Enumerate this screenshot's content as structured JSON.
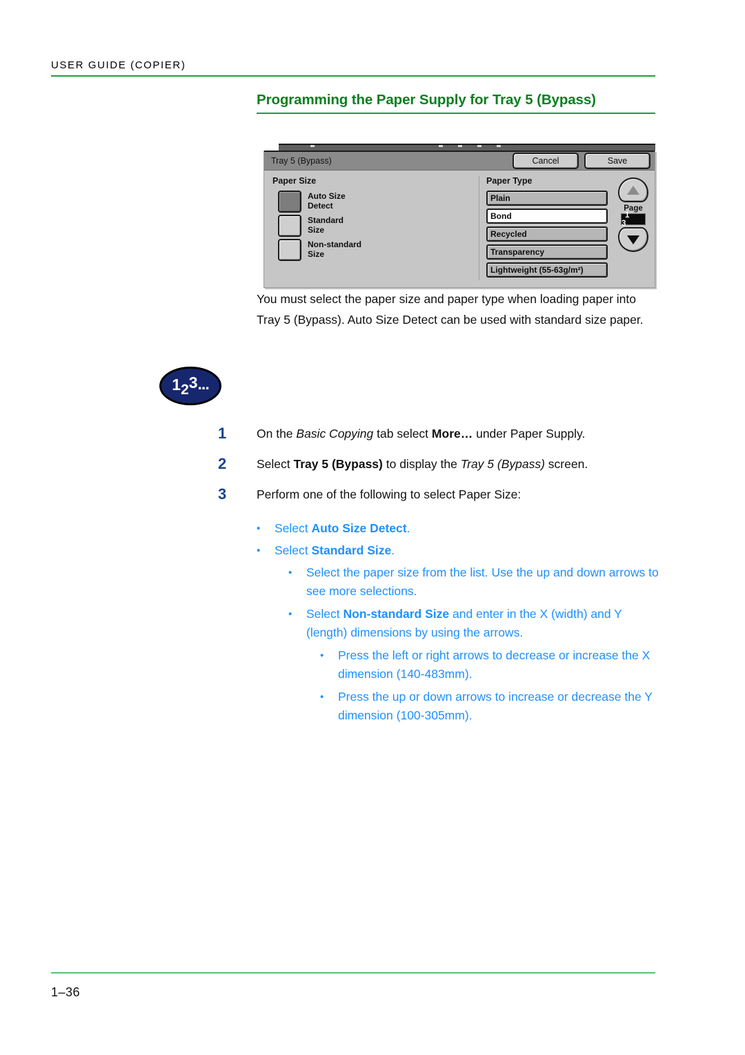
{
  "running_header": {
    "text": "User Guide (Copier)"
  },
  "section": {
    "title": "Programming the Paper Supply for Tray 5 (Bypass)"
  },
  "figure": {
    "titlebar": {
      "title": "Tray 5 (Bypass)",
      "cancel_label": "Cancel",
      "save_label": "Save"
    },
    "paper_size": {
      "group_label": "Paper Size",
      "options": [
        {
          "line1": "Auto Size",
          "line2": "Detect",
          "selected": true
        },
        {
          "line1": "Standard",
          "line2": "Size",
          "selected": false
        },
        {
          "line1": "Non-standard",
          "line2": "Size",
          "selected": false
        }
      ]
    },
    "paper_type": {
      "group_label": "Paper Type",
      "options": [
        {
          "label": "Plain",
          "selected": false
        },
        {
          "label": "Bond",
          "selected": true
        },
        {
          "label": "Recycled",
          "selected": false
        },
        {
          "label": "Transparency",
          "selected": false
        },
        {
          "label": "Lightweight (55-63g/m²)",
          "selected": false
        }
      ]
    },
    "pager": {
      "up_icon": "triangle-up-icon",
      "down_icon": "triangle-down-icon",
      "page_label": "Page",
      "page_value": "1 3"
    }
  },
  "intro": {
    "text": "You must select the paper size and paper type when loading paper into Tray 5 (Bypass).  Auto Size Detect can be used with standard size paper."
  },
  "badge": {
    "digit1": "1",
    "digit2": "2",
    "digit3": "3",
    "dots": "..."
  },
  "steps": [
    {
      "num": "1",
      "segments": [
        {
          "text": "On the ",
          "style": "normal"
        },
        {
          "text": "Basic Copying",
          "style": "italic"
        },
        {
          "text": " tab select ",
          "style": "normal"
        },
        {
          "text": "More…",
          "style": "bold"
        },
        {
          "text": " under Paper Supply.",
          "style": "normal"
        }
      ]
    },
    {
      "num": "2",
      "segments": [
        {
          "text": "Select ",
          "style": "normal"
        },
        {
          "text": "Tray 5 (Bypass)",
          "style": "bold"
        },
        {
          "text": " to display the ",
          "style": "normal"
        },
        {
          "text": "Tray 5 (Bypass)",
          "style": "italic"
        },
        {
          "text": " screen.",
          "style": "normal"
        }
      ]
    },
    {
      "num": "3",
      "segments": [
        {
          "text": "Perform one of the following to select Paper Size:",
          "style": "normal"
        }
      ]
    }
  ],
  "bullets": [
    {
      "level": 1,
      "marker": "•",
      "segments": [
        {
          "text": "Select ",
          "style": "normal"
        },
        {
          "text": "Auto Size Detect",
          "style": "bold"
        },
        {
          "text": ".",
          "style": "normal"
        }
      ]
    },
    {
      "level": 1,
      "marker": "•",
      "segments": [
        {
          "text": "Select ",
          "style": "normal"
        },
        {
          "text": "Standard Size",
          "style": "bold"
        },
        {
          "text": ".",
          "style": "normal"
        }
      ]
    },
    {
      "level": 2,
      "marker": "•",
      "segments": [
        {
          "text": "Select the paper size from the list. Use the up and down arrows to see more selections.",
          "style": "normal"
        }
      ]
    },
    {
      "level": 2,
      "marker": "•",
      "segments": [
        {
          "text": "Select ",
          "style": "normal"
        },
        {
          "text": "Non-standard Size",
          "style": "bold"
        },
        {
          "text": " and enter in the X (width) and Y (length) dimensions by using the arrows.",
          "style": "normal"
        }
      ]
    },
    {
      "level": 3,
      "marker": "•",
      "segments": [
        {
          "text": "Press the left or right arrows to decrease or increase the X dimension (140-483mm).",
          "style": "normal"
        }
      ]
    },
    {
      "level": 3,
      "marker": "•",
      "segments": [
        {
          "text": "Press the up or down arrows to increase or decrease the Y dimension (100-305mm).",
          "style": "normal"
        }
      ]
    }
  ],
  "footer": {
    "page_number": "1–36"
  },
  "colors": {
    "green": "#0a8020",
    "rule_green": "#1f9d3f",
    "step_blue": "#17478a",
    "bullet_blue": "#1e90ff",
    "badge_navy": "#16276e"
  }
}
